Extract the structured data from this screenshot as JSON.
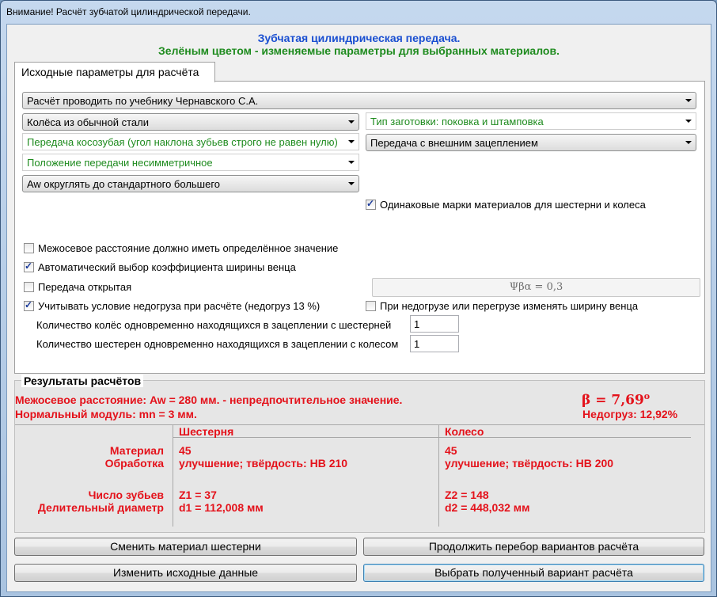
{
  "window": {
    "title": "Внимание! Расчёт зубчатой цилиндрической передачи."
  },
  "header": {
    "line1": "Зубчатая цилиндрическая передача.",
    "line2": "Зелёным цветом - изменяемые параметры для выбранных материалов."
  },
  "tab": {
    "label": "Исходные параметры для расчёта"
  },
  "selects": {
    "textbook": "Расчёт проводить по учебнику Чернавского С.А.",
    "steel": "Колёса из обычной стали",
    "blank_type": "Тип заготовки: поковка и штамповка",
    "gear_type": "Передача косозубая (угол наклона зубьев строго не равен нулю)",
    "engagement": "Передача с внешним зацеплением",
    "position": "Положение передачи несимметричное",
    "aw_round": "Aw округлять до стандартного большего"
  },
  "checks": {
    "same_materials": {
      "label": "Одинаковые марки материалов для шестерни и колеса",
      "checked": true
    },
    "fixed_distance": {
      "label": "Межосевое расстояние должно иметь определённое значение",
      "checked": false
    },
    "auto_width": {
      "label": "Автоматический выбор коэффициента ширины венца",
      "checked": true
    },
    "open_gear": {
      "label": "Передача открытая",
      "checked": false
    },
    "underload": {
      "label": "Учитывать условие недогруза при расчёте (недогруз 13 %)",
      "checked": true
    },
    "change_width": {
      "label": "При недогрузе или перегрузе изменять ширину венца",
      "checked": false
    }
  },
  "psi_field": "Ψβα = 0,3",
  "counts": {
    "wheels_label": "Количество колёс одновременно находящихся в зацеплении с шестерней",
    "wheels_value": "1",
    "pinions_label": "Количество шестерен одновременно находящихся в зацеплении с колесом",
    "pinions_value": "1"
  },
  "results": {
    "title": "Результаты расчётов",
    "distance": "Межосевое расстояние:  Aw = 280 мм. - непредпочтительное значение.",
    "module": "Нормальный модуль:  mn = 3 мм.",
    "beta": "β = 7,69",
    "beta_deg": "o",
    "underload": "Недогруз: 12,92%",
    "col_pinion": "Шестерня",
    "col_wheel": "Колесо",
    "row_material": "Материал",
    "row_treatment": "Обработка",
    "row_teeth": "Число зубьев",
    "row_diameter": "Делительный диаметр",
    "pinion_material": "45",
    "pinion_treatment": "улучшение;  твёрдость: HB 210",
    "pinion_teeth": "Z1 = 37",
    "pinion_diameter": "d1 = 112,008 мм",
    "wheel_material": "45",
    "wheel_treatment": "улучшение;  твёрдость: HB 200",
    "wheel_teeth": "Z2 = 148",
    "wheel_diameter": "d2 = 448,032 мм"
  },
  "buttons": {
    "change_material": "Сменить материал шестерни",
    "continue": "Продолжить перебор вариантов расчёта",
    "edit_input": "Изменить исходные данные",
    "select_variant": "Выбрать полученный вариант расчёта"
  },
  "colors": {
    "accent_blue": "#1a4fd1",
    "editable_green": "#1e8b1e",
    "result_red": "#e4121b"
  }
}
